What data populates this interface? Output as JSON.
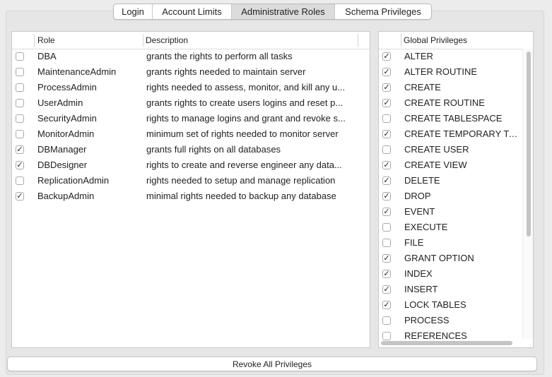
{
  "tabs": [
    {
      "label": "Login",
      "active": false
    },
    {
      "label": "Account Limits",
      "active": false
    },
    {
      "label": "Administrative Roles",
      "active": true
    },
    {
      "label": "Schema Privileges",
      "active": false
    }
  ],
  "roles_table": {
    "headers": {
      "role": "Role",
      "description": "Description"
    },
    "rows": [
      {
        "checked": false,
        "role": "DBA",
        "description": "grants the rights to perform all tasks"
      },
      {
        "checked": false,
        "role": "MaintenanceAdmin",
        "description": "grants rights needed to maintain server"
      },
      {
        "checked": false,
        "role": "ProcessAdmin",
        "description": "rights needed to assess, monitor, and kill any u..."
      },
      {
        "checked": false,
        "role": "UserAdmin",
        "description": "grants rights to create users logins and reset p..."
      },
      {
        "checked": false,
        "role": "SecurityAdmin",
        "description": "rights to manage logins and grant and revoke s..."
      },
      {
        "checked": false,
        "role": "MonitorAdmin",
        "description": "minimum set of rights needed to monitor server"
      },
      {
        "checked": true,
        "role": "DBManager",
        "description": "grants full rights on all databases"
      },
      {
        "checked": true,
        "role": "DBDesigner",
        "description": "rights to create and reverse engineer any data..."
      },
      {
        "checked": false,
        "role": "ReplicationAdmin",
        "description": "rights needed to setup and manage replication"
      },
      {
        "checked": true,
        "role": "BackupAdmin",
        "description": "minimal rights needed to backup any database"
      }
    ]
  },
  "privileges_table": {
    "header": "Global Privileges",
    "rows": [
      {
        "checked": true,
        "name": "ALTER"
      },
      {
        "checked": true,
        "name": "ALTER ROUTINE"
      },
      {
        "checked": true,
        "name": "CREATE"
      },
      {
        "checked": true,
        "name": "CREATE ROUTINE"
      },
      {
        "checked": false,
        "name": "CREATE TABLESPACE"
      },
      {
        "checked": true,
        "name": "CREATE TEMPORARY TAB..."
      },
      {
        "checked": false,
        "name": "CREATE USER"
      },
      {
        "checked": true,
        "name": "CREATE VIEW"
      },
      {
        "checked": true,
        "name": "DELETE"
      },
      {
        "checked": true,
        "name": "DROP"
      },
      {
        "checked": true,
        "name": "EVENT"
      },
      {
        "checked": false,
        "name": "EXECUTE"
      },
      {
        "checked": false,
        "name": "FILE"
      },
      {
        "checked": true,
        "name": "GRANT OPTION"
      },
      {
        "checked": true,
        "name": "INDEX"
      },
      {
        "checked": true,
        "name": "INSERT"
      },
      {
        "checked": true,
        "name": "LOCK TABLES"
      },
      {
        "checked": false,
        "name": "PROCESS"
      },
      {
        "checked": false,
        "name": "REFERENCES"
      }
    ]
  },
  "revoke_button": {
    "label": "Revoke All Privileges"
  },
  "icons": {
    "checkmark": "checkmark-icon"
  }
}
